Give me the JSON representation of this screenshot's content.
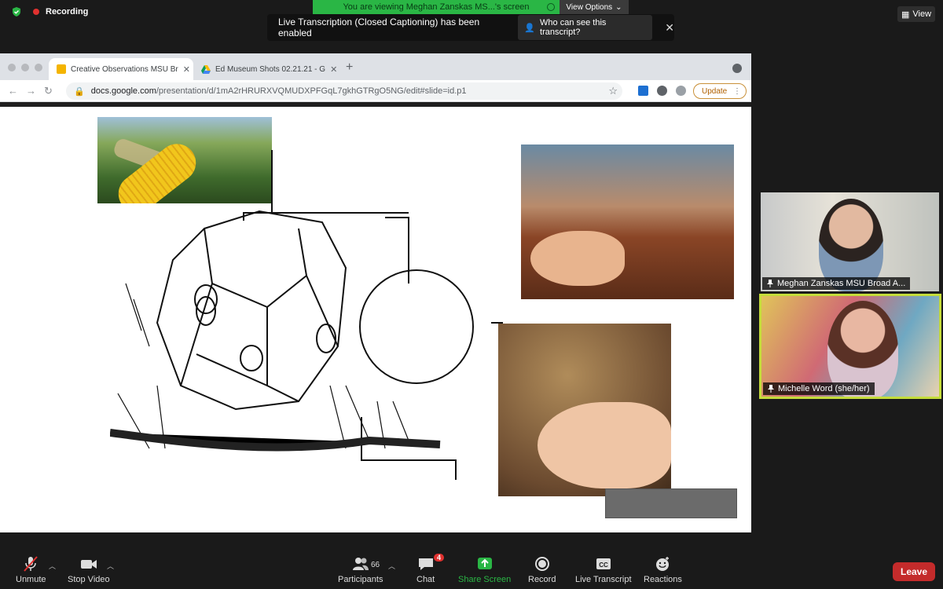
{
  "top": {
    "recording_label": "Recording",
    "viewing_text": "You are viewing Meghan Zanskas MS...'s screen",
    "view_options": "View Options",
    "view_button": "View"
  },
  "banner": {
    "message": "Live Transcription (Closed Captioning) has been enabled",
    "who_can_see": "Who can see this transcript?"
  },
  "browser": {
    "tabs": [
      {
        "label": "Creative Observations MSU Br"
      },
      {
        "label": "Ed Museum Shots 02.21.21 - G"
      }
    ],
    "url_host": "docs.google.com",
    "url_path": "/presentation/d/1mA2rHRURXVQMUDXPFGqL7gkhGTRgO5NG/edit#slide=id.p1",
    "update_label": "Update"
  },
  "participants": [
    {
      "name": "Meghan Zanskas MSU Broad A..."
    },
    {
      "name": "Michelle Word (she/her)"
    }
  ],
  "toolbar": {
    "unmute": "Unmute",
    "stop_video": "Stop Video",
    "participants": "Participants",
    "participants_count": "66",
    "chat": "Chat",
    "chat_badge": "4",
    "share_screen": "Share Screen",
    "record": "Record",
    "live_transcript": "Live Transcript",
    "reactions": "Reactions",
    "leave": "Leave"
  },
  "colors": {
    "share_green": "#2ab645",
    "leave_red": "#c42b2b",
    "active_speaker": "#c4dc3a"
  }
}
